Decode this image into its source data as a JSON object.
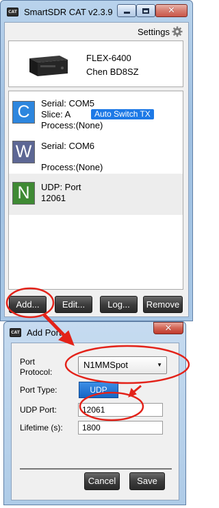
{
  "main_window": {
    "title": "SmartSDR CAT v2.3.9",
    "icon_text": "CAT",
    "settings_label": "Settings",
    "radio": {
      "model": "FLEX-6400",
      "owner": "Chen BD8SZ"
    },
    "ports": [
      {
        "letter": "C",
        "color": "#2d86de",
        "line1": "Serial: COM5",
        "line2": "Slice: A",
        "line3": "Process:(None)",
        "badge": "Auto Switch TX"
      },
      {
        "letter": "W",
        "color": "#5d6794",
        "line1": "Serial: COM6",
        "line2": "",
        "line3": "Process:(None)"
      },
      {
        "letter": "N",
        "color": "#3f8a34",
        "line1": "UDP: Port",
        "line2": "12061",
        "selected": true
      }
    ],
    "buttons": {
      "add": "Add...",
      "edit": "Edit...",
      "log": "Log...",
      "remove": "Remove"
    },
    "close_glyph": "✕"
  },
  "dialog": {
    "title": "Add Port",
    "icon_text": "CAT",
    "close_glyph": "✕",
    "port_protocol_label": "Port\nProtocol:",
    "port_protocol_value": "N1MMSpot",
    "port_type_label": "Port Type:",
    "port_type_value": "UDP",
    "udp_port_label": "UDP Port:",
    "udp_port_value": "12061",
    "lifetime_label": "Lifetime (s):",
    "lifetime_value": "1800",
    "cancel": "Cancel",
    "save": "Save"
  },
  "colors": {
    "annotation": "#e32219",
    "highlight_badge": "#1d79e6"
  }
}
